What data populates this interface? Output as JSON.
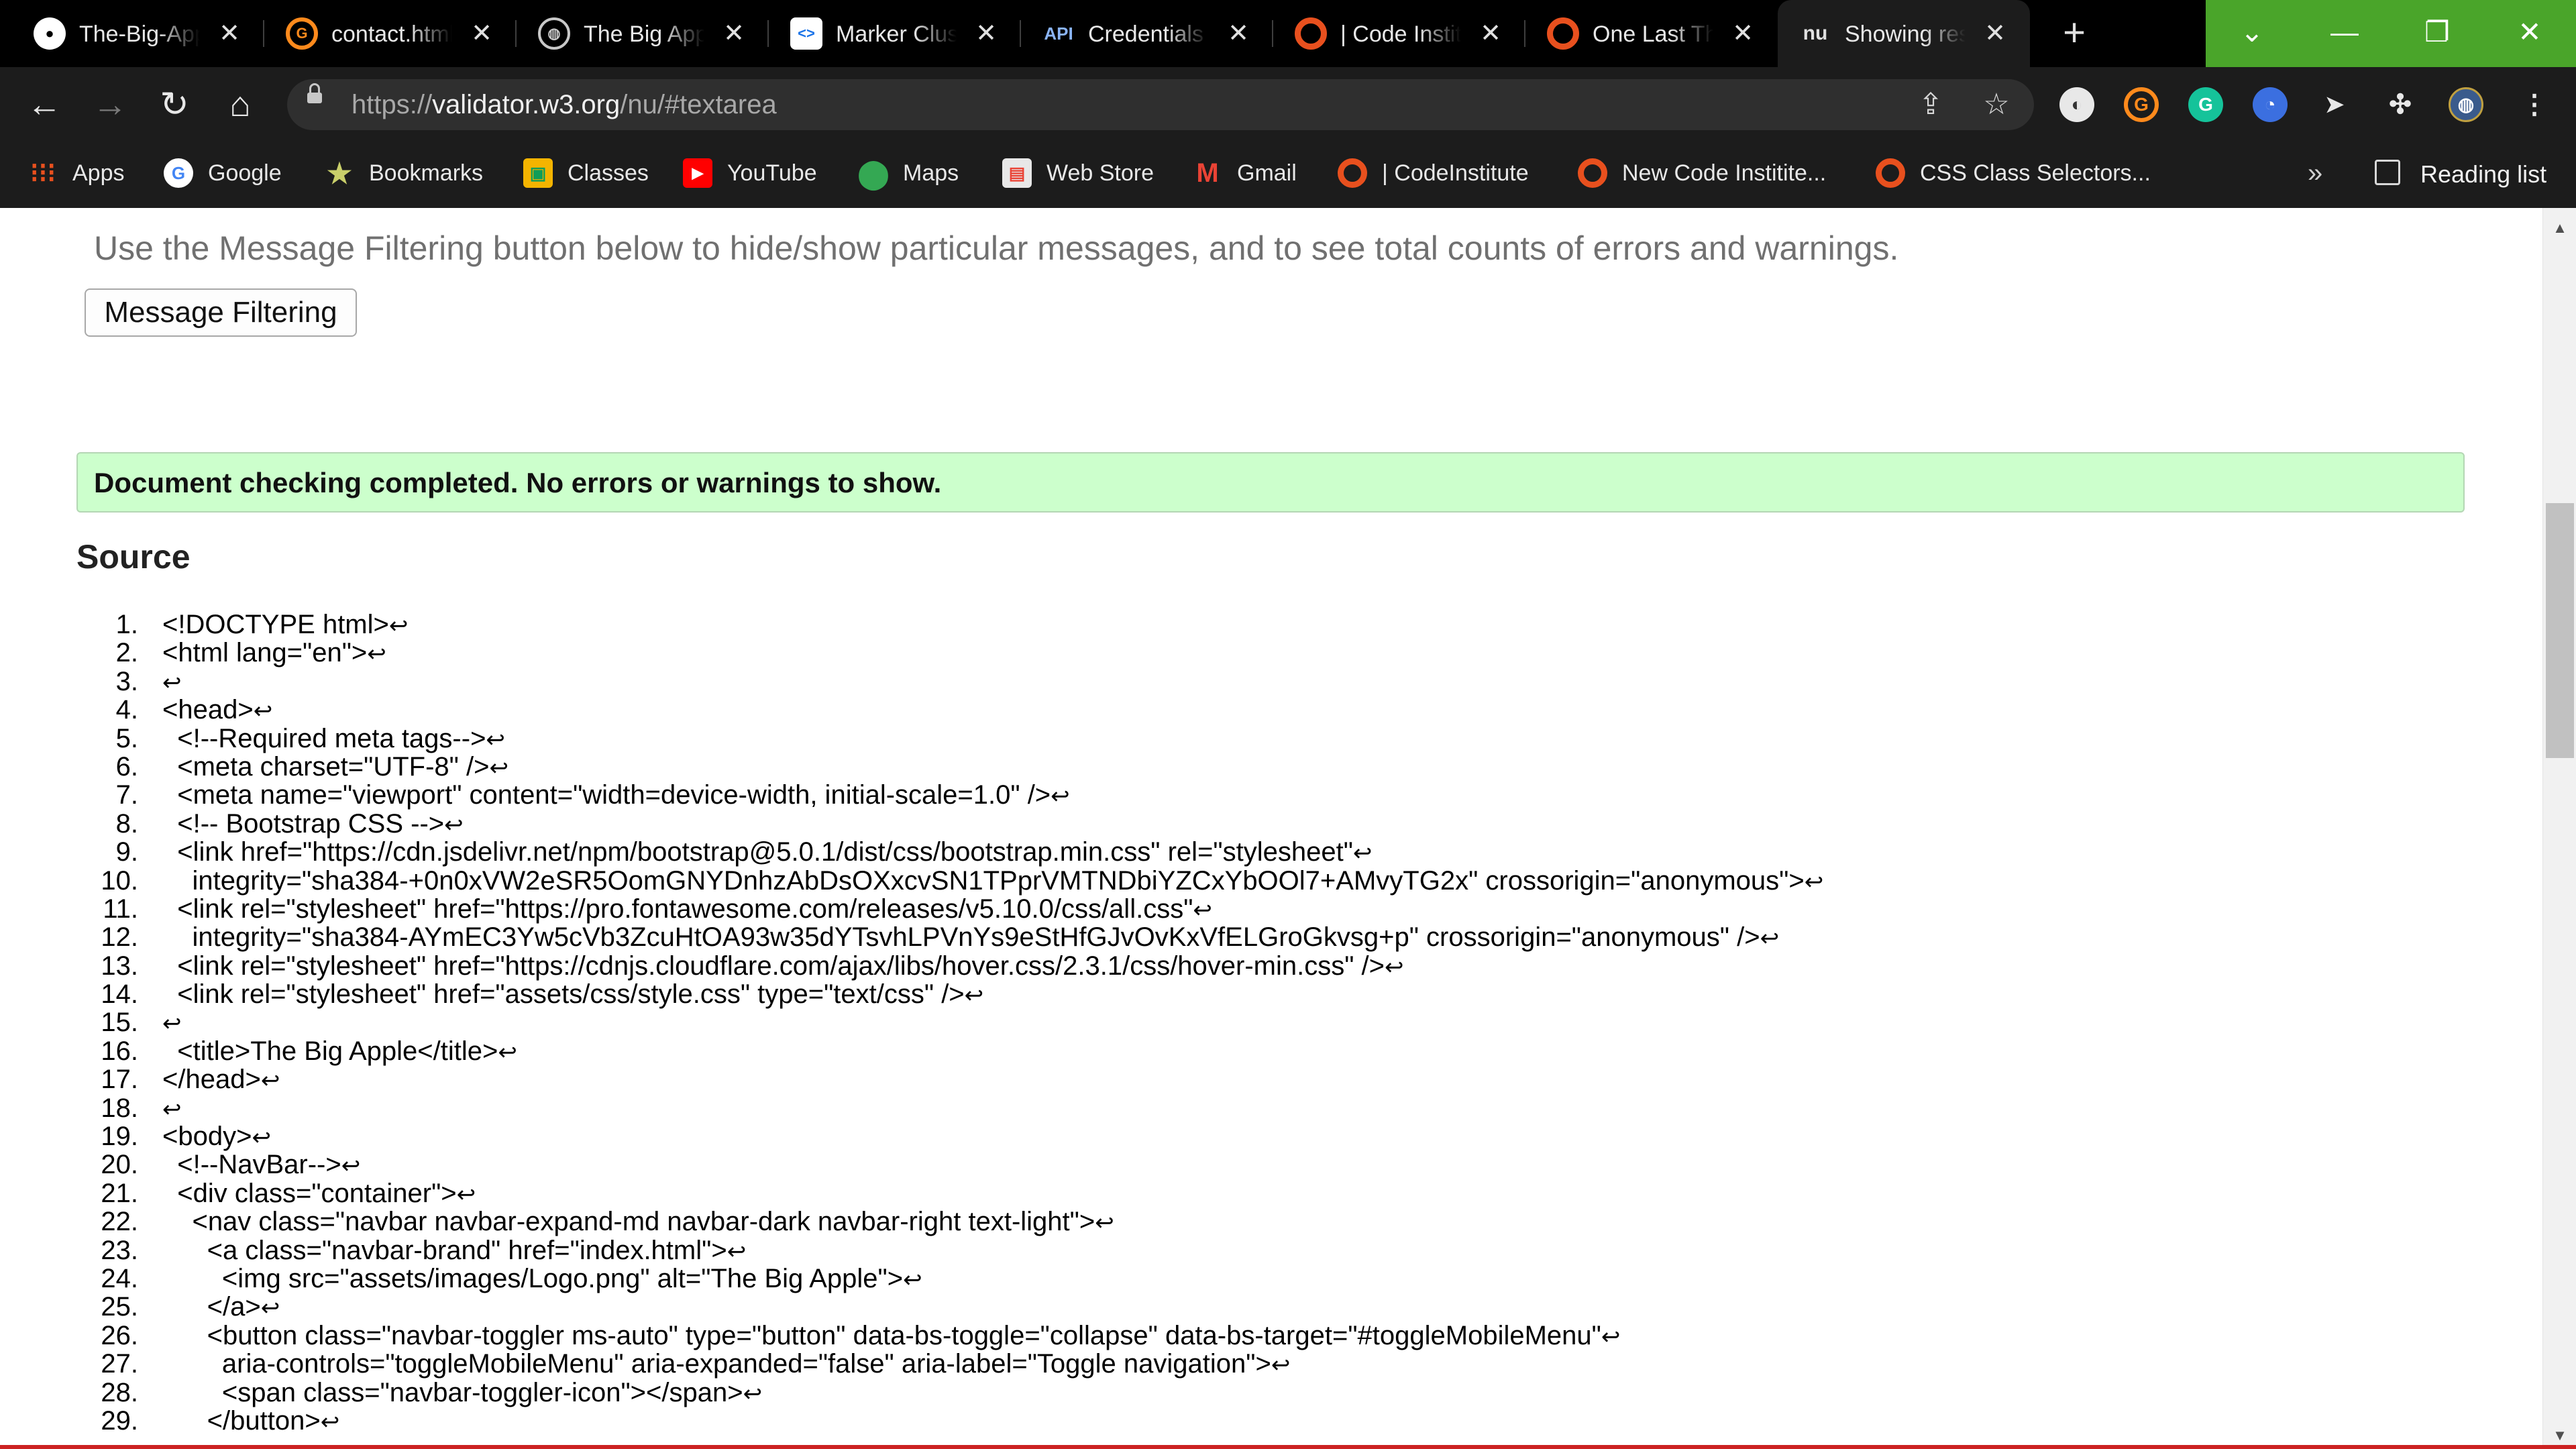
{
  "browser": {
    "tabs": [
      {
        "title": "The-Big-Apple",
        "icon": "github-icon",
        "active": false
      },
      {
        "title": "contact.html",
        "icon": "gitpod-icon",
        "active": false
      },
      {
        "title": "The Big Apple",
        "icon": "globe-icon",
        "active": false
      },
      {
        "title": "Marker Clustering",
        "icon": "google-developers-icon",
        "active": false
      },
      {
        "title": "Credentials",
        "icon": "api-icon",
        "badge": "API",
        "active": false
      },
      {
        "title": "| Code Institute",
        "icon": "code-institute-icon",
        "active": false
      },
      {
        "title": "One Last Thing",
        "icon": "code-institute-icon",
        "active": false
      },
      {
        "title": "Showing results",
        "icon": "nu-validator-icon",
        "badge": "nu",
        "active": true
      }
    ],
    "url": {
      "scheme": "https://",
      "host": "validator.w3.org",
      "path": "/nu/#textarea"
    },
    "bookmarks": [
      {
        "label": "Apps",
        "icon": "apps-grid-icon"
      },
      {
        "label": "Google",
        "icon": "google-icon"
      },
      {
        "label": "Bookmarks",
        "icon": "star-icon"
      },
      {
        "label": "Classes",
        "icon": "classroom-icon"
      },
      {
        "label": "YouTube",
        "icon": "youtube-icon"
      },
      {
        "label": "Maps",
        "icon": "maps-pin-icon"
      },
      {
        "label": "Web Store",
        "icon": "web-store-icon"
      },
      {
        "label": "Gmail",
        "icon": "gmail-icon"
      },
      {
        "label": "| CodeInstitute",
        "icon": "code-institute-icon"
      },
      {
        "label": "New Code Institite...",
        "icon": "code-institute-icon"
      },
      {
        "label": "CSS Class Selectors...",
        "icon": "code-institute-icon"
      }
    ],
    "reading_list": "Reading list",
    "accent_color": "#4aa52a"
  },
  "page": {
    "filter_note": "Use the Message Filtering button below to hide/show particular messages, and to see total counts of errors and warnings.",
    "filter_button": "Message Filtering",
    "result_message": "Document checking completed. No errors or warnings to show.",
    "source_heading": "Source",
    "return_symbol": "↩",
    "source_lines": [
      {
        "n": "1.",
        "text": "<!DOCTYPE html>"
      },
      {
        "n": "2.",
        "text": "<html lang=\"en\">"
      },
      {
        "n": "3.",
        "text": ""
      },
      {
        "n": "4.",
        "text": "<head>"
      },
      {
        "n": "5.",
        "text": "  <!--Required meta tags-->"
      },
      {
        "n": "6.",
        "text": "  <meta charset=\"UTF-8\" />"
      },
      {
        "n": "7.",
        "text": "  <meta name=\"viewport\" content=\"width=device-width, initial-scale=1.0\" />"
      },
      {
        "n": "8.",
        "text": "  <!-- Bootstrap CSS -->"
      },
      {
        "n": "9.",
        "text": "  <link href=\"https://cdn.jsdelivr.net/npm/bootstrap@5.0.1/dist/css/bootstrap.min.css\" rel=\"stylesheet\""
      },
      {
        "n": "10.",
        "text": "    integrity=\"sha384-+0n0xVW2eSR5OomGNYDnhzAbDsOXxcvSN1TPprVMTNDbiYZCxYbOOl7+AMvyTG2x\" crossorigin=\"anonymous\">"
      },
      {
        "n": "11.",
        "text": "  <link rel=\"stylesheet\" href=\"https://pro.fontawesome.com/releases/v5.10.0/css/all.css\""
      },
      {
        "n": "12.",
        "text": "    integrity=\"sha384-AYmEC3Yw5cVb3ZcuHtOA93w35dYTsvhLPVnYs9eStHfGJvOvKxVfELGroGkvsg+p\" crossorigin=\"anonymous\" />"
      },
      {
        "n": "13.",
        "text": "  <link rel=\"stylesheet\" href=\"https://cdnjs.cloudflare.com/ajax/libs/hover.css/2.3.1/css/hover-min.css\" />"
      },
      {
        "n": "14.",
        "text": "  <link rel=\"stylesheet\" href=\"assets/css/style.css\" type=\"text/css\" />"
      },
      {
        "n": "15.",
        "text": ""
      },
      {
        "n": "16.",
        "text": "  <title>The Big Apple</title>"
      },
      {
        "n": "17.",
        "text": "</head>"
      },
      {
        "n": "18.",
        "text": ""
      },
      {
        "n": "19.",
        "text": "<body>"
      },
      {
        "n": "20.",
        "text": "  <!--NavBar-->"
      },
      {
        "n": "21.",
        "text": "  <div class=\"container\">"
      },
      {
        "n": "22.",
        "text": "    <nav class=\"navbar navbar-expand-md navbar-dark navbar-right text-light\">"
      },
      {
        "n": "23.",
        "text": "      <a class=\"navbar-brand\" href=\"index.html\">"
      },
      {
        "n": "24.",
        "text": "        <img src=\"assets/images/Logo.png\" alt=\"The Big Apple\">"
      },
      {
        "n": "25.",
        "text": "      </a>"
      },
      {
        "n": "26.",
        "text": "      <button class=\"navbar-toggler ms-auto\" type=\"button\" data-bs-toggle=\"collapse\" data-bs-target=\"#toggleMobileMenu\""
      },
      {
        "n": "27.",
        "text": "        aria-controls=\"toggleMobileMenu\" aria-expanded=\"false\" aria-label=\"Toggle navigation\">"
      },
      {
        "n": "28.",
        "text": "        <span class=\"navbar-toggler-icon\"></span>"
      },
      {
        "n": "29.",
        "text": "      </button>"
      }
    ]
  }
}
